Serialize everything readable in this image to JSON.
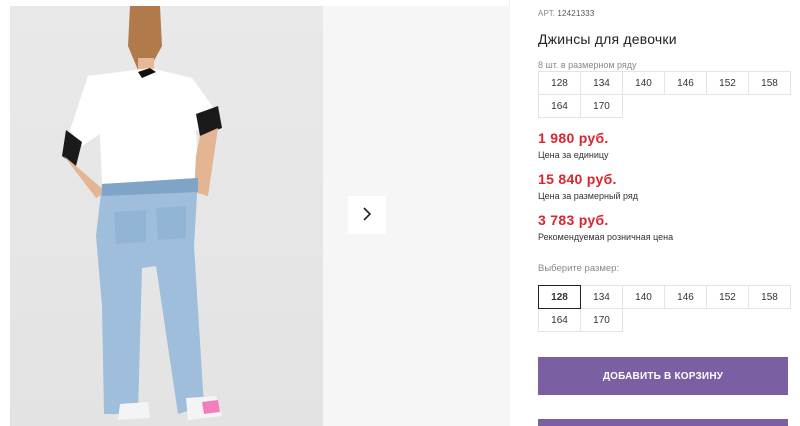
{
  "product": {
    "art_label": "АРТ.",
    "art_value": "12421333",
    "title": "Джинсы для девочки",
    "pack_note": "8 шт. в размерном ряду"
  },
  "pack_sizes": [
    "128",
    "134",
    "140",
    "146",
    "152",
    "158",
    "164",
    "170"
  ],
  "prices": {
    "unit_price": "1 980 руб.",
    "unit_label": "Цена за единицу",
    "pack_price": "15 840 руб.",
    "pack_label": "Цена за размерный ряд",
    "retail_price": "3 783 руб.",
    "retail_label": "Рекомендуемая розничная цена"
  },
  "size_select": {
    "label": "Выберите размер:",
    "options": [
      "128",
      "134",
      "140",
      "146",
      "152",
      "158",
      "164",
      "170"
    ],
    "selected": "128"
  },
  "actions": {
    "add_to_cart": "ДОБАВИТЬ В КОРЗИНУ"
  },
  "icons": {
    "next": "chevron-right-icon"
  },
  "colors": {
    "accent": "#7b5fa3",
    "price": "#d9252f"
  }
}
